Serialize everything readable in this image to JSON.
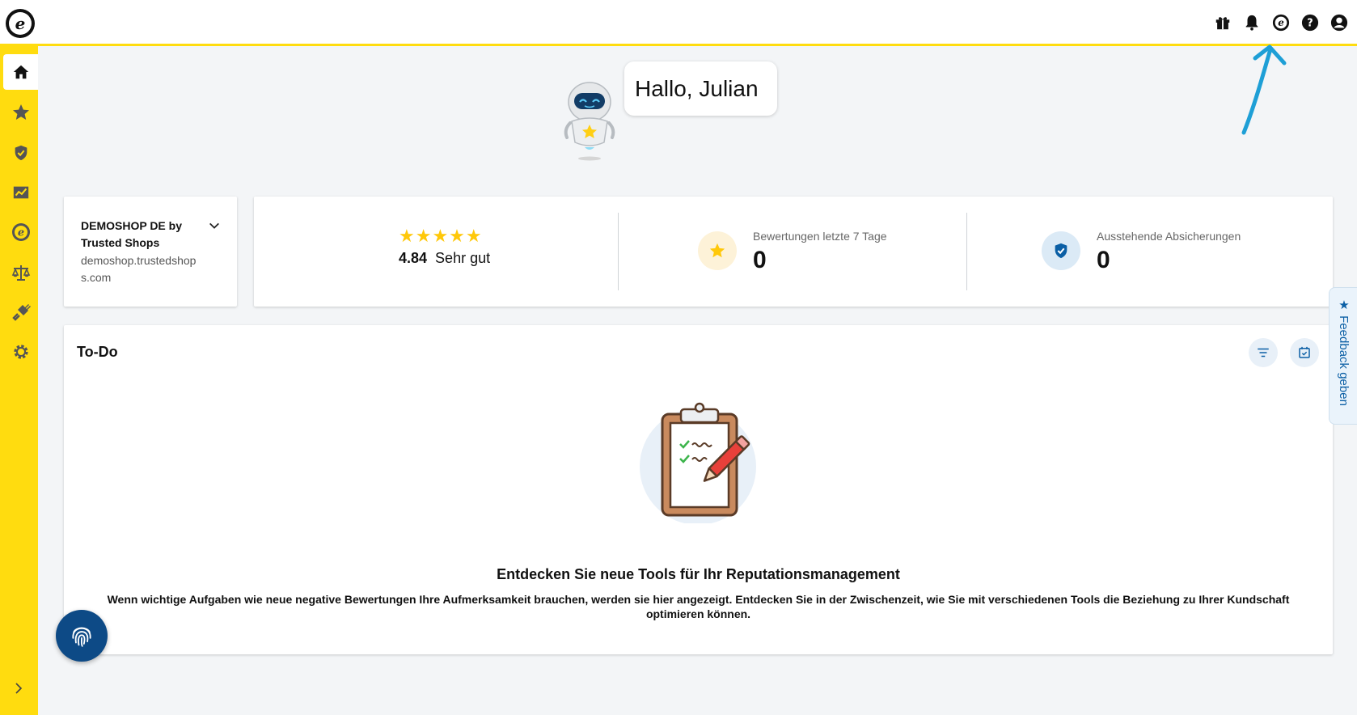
{
  "app": {
    "logo_letter": "e"
  },
  "topbar": {
    "icons": [
      "gift-icon",
      "bell-icon",
      "trustedshops-icon",
      "help-icon",
      "account-icon"
    ]
  },
  "sidebar": {
    "items": [
      "home-icon",
      "star-icon",
      "shield-icon",
      "chart-icon",
      "trustedshops-icon",
      "scale-icon",
      "plug-icon",
      "gear-icon"
    ],
    "active": "home-icon",
    "expand_icon": "chevron-right-icon",
    "accent_color": "#ffdc0f"
  },
  "greeting": {
    "text": "Hallo, Julian"
  },
  "shop": {
    "name": "DEMOSHOP DE by Trusted Shops",
    "url": "demoshop.trustedshops.com"
  },
  "rating": {
    "stars": "★★★★★",
    "value": "4.84",
    "label": "Sehr gut"
  },
  "stats": {
    "reviews_label": "Bewertungen letzte 7 Tage",
    "reviews_value": "0",
    "pending_label": "Ausstehende Absicherungen",
    "pending_value": "0"
  },
  "todo": {
    "title": "To-Do",
    "heading": "Entdecken Sie neue Tools für Ihr Reputationsmanagement",
    "text": "Wenn wichtige Aufgaben wie neue negative Bewertungen Ihre Aufmerksamkeit brauchen, werden sie hier angezeigt. Entdecken Sie in der Zwischenzeit, wie Sie mit verschiedenen Tools die Beziehung zu Ihrer Kundschaft optimieren können."
  },
  "feedback": {
    "label": "★ Feedback geben"
  }
}
